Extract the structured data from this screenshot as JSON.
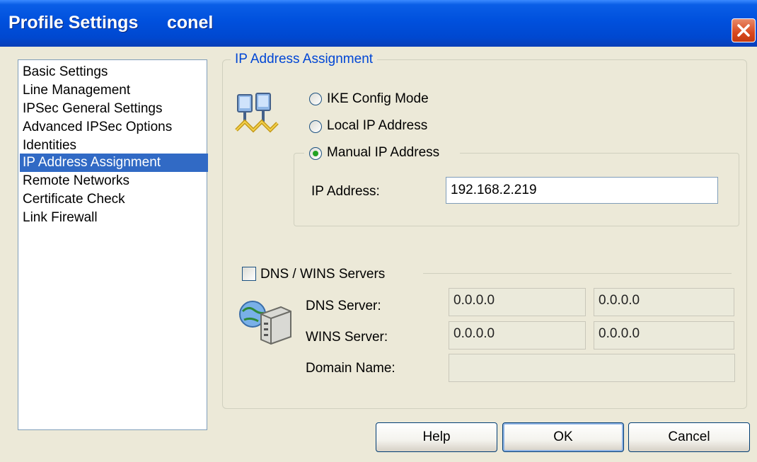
{
  "window": {
    "title": "Profile Settings",
    "user": "conel"
  },
  "sidebar": {
    "items": [
      {
        "label": "Basic Settings"
      },
      {
        "label": "Line Management"
      },
      {
        "label": "IPSec General Settings"
      },
      {
        "label": "Advanced IPSec Options"
      },
      {
        "label": "Identities"
      },
      {
        "label": "IP Address Assignment",
        "selected": true
      },
      {
        "label": "Remote Networks"
      },
      {
        "label": "Certificate Check"
      },
      {
        "label": "Link Firewall"
      }
    ]
  },
  "assignment": {
    "group_label": "IP Address Assignment",
    "options": [
      {
        "label": "IKE Config Mode",
        "checked": false
      },
      {
        "label": "Local IP Address",
        "checked": false
      },
      {
        "label": "Manual IP Address",
        "checked": true
      }
    ],
    "ip_address_label": "IP Address:",
    "ip_address_value": "192.168.2.219"
  },
  "dns": {
    "checkbox_label": "DNS / WINS Servers",
    "checked": false,
    "dns_server_label": "DNS Server:",
    "dns_server_1": "0.0.0.0",
    "dns_server_2": "0.0.0.0",
    "wins_server_label": "WINS Server:",
    "wins_server_1": "0.0.0.0",
    "wins_server_2": "0.0.0.0",
    "domain_name_label": "Domain Name:",
    "domain_name_value": ""
  },
  "buttons": {
    "help": "Help",
    "ok": "OK",
    "cancel": "Cancel"
  },
  "colors": {
    "title_bar": "#0050dd",
    "selection": "#316ac5",
    "group_label": "#0046d5",
    "dialog_background": "#ece9d8"
  },
  "icons": [
    "close-icon",
    "network-computers-icon",
    "dns-server-icon"
  ]
}
